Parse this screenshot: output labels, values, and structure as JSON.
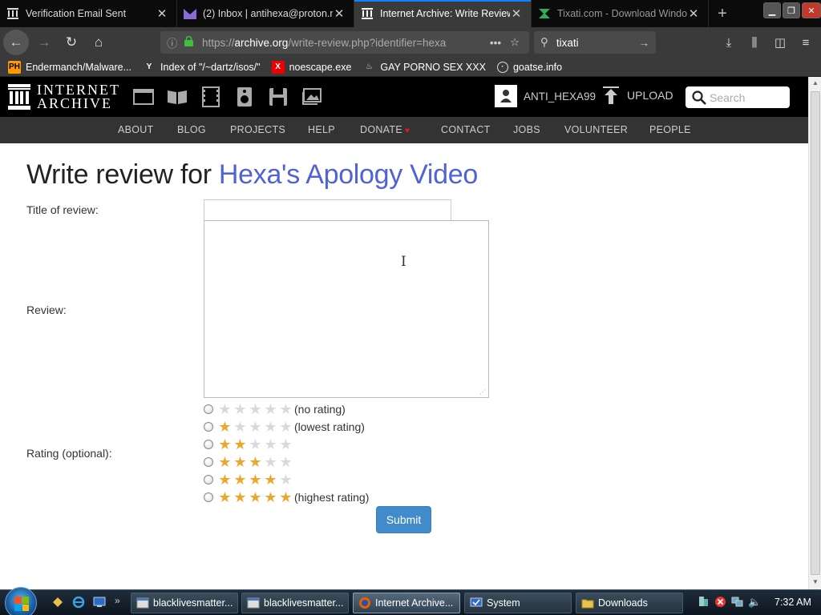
{
  "browser": {
    "tabs": [
      {
        "title": "Verification Email Sent",
        "icon": "archive-icon",
        "active": false
      },
      {
        "title": "(2) Inbox | antihexa@proton.m",
        "icon": "protonmail-icon",
        "active": false
      },
      {
        "title": "Internet Archive: Write Review",
        "icon": "archive-icon",
        "active": true
      },
      {
        "title": "Tixati.com - Download Windo",
        "icon": "tixati-icon",
        "active": false
      }
    ],
    "url_domain": "archive.org",
    "url_prefix": "https://",
    "url_rest": "/write-review.php?identifier=hexa",
    "search_value": "tixati",
    "bookmarks": [
      {
        "label": "Endermanch/Malware...",
        "icon": "ph-icon",
        "badge": "PH"
      },
      {
        "label": "Index of \"/~dartz/isos/\"",
        "icon": "ycombinator-icon",
        "badge": "Y"
      },
      {
        "label": "noescape.exe",
        "icon": "x-icon",
        "badge": "X"
      },
      {
        "label": "GAY PORNO SEX XXX",
        "icon": "bookmark-icon",
        "badge": ""
      },
      {
        "label": "goatse.info",
        "icon": "globe-icon",
        "badge": ""
      }
    ]
  },
  "ia": {
    "logo_line1": "INTERNET",
    "logo_line2": "ARCHIVE",
    "username": "ANTI_HEXA99",
    "upload_label": "UPLOAD",
    "search_placeholder": "Search",
    "nav": [
      "ABOUT",
      "BLOG",
      "PROJECTS",
      "HELP",
      "DONATE",
      "CONTACT",
      "JOBS",
      "VOLUNTEER",
      "PEOPLE"
    ]
  },
  "page": {
    "heading_prefix": "Write review for ",
    "item_title": "Hexa's Apology Video",
    "title_label": "Title of review:",
    "title_value": "",
    "review_label": "Review:",
    "review_value": "",
    "rating_label": "Rating (optional):",
    "ratings": [
      {
        "stars": 0,
        "text": "(no rating)"
      },
      {
        "stars": 1,
        "text": "(lowest rating)"
      },
      {
        "stars": 2,
        "text": ""
      },
      {
        "stars": 3,
        "text": ""
      },
      {
        "stars": 4,
        "text": ""
      },
      {
        "stars": 5,
        "text": "(highest rating)"
      }
    ],
    "submit_label": "Submit"
  },
  "taskbar": {
    "tasks": [
      {
        "label": "blacklivesmatter...",
        "active": false
      },
      {
        "label": "blacklivesmatter...",
        "active": false
      },
      {
        "label": "Internet Archive...",
        "active": true
      },
      {
        "label": "System",
        "active": false
      },
      {
        "label": "Downloads",
        "active": false
      }
    ],
    "clock": "7:32 AM"
  },
  "colors": {
    "accent_blue": "#0a84ff",
    "item_link": "#4f62d6",
    "star_on": "#e9a92e",
    "star_off": "#d9d9d9",
    "submit_bg": "#428bca",
    "lock_green": "#3fbf3f"
  }
}
